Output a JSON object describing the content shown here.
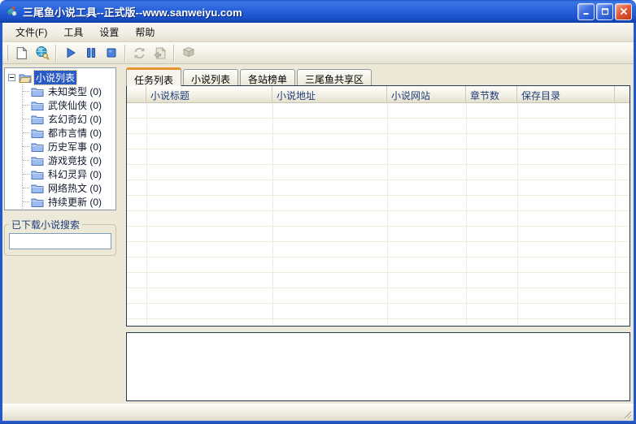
{
  "window": {
    "title": "三尾鱼小说工具--正式版--www.sanweiyu.com",
    "controls": [
      {
        "name": "minimize"
      },
      {
        "name": "maximize"
      },
      {
        "name": "close"
      }
    ]
  },
  "menu": {
    "items": [
      {
        "label": "文件(F)"
      },
      {
        "label": "工具"
      },
      {
        "label": "设置"
      },
      {
        "label": "帮助"
      }
    ]
  },
  "toolbar": {
    "buttons": [
      {
        "name": "new-task",
        "icon": "new-document-icon",
        "enabled": true
      },
      {
        "name": "search",
        "icon": "search-globe-icon",
        "enabled": true
      },
      {
        "name": "start",
        "icon": "play-icon",
        "enabled": true
      },
      {
        "name": "pause",
        "icon": "pause-icon",
        "enabled": true
      },
      {
        "name": "stop",
        "icon": "stop-icon",
        "enabled": true
      },
      {
        "name": "refresh",
        "icon": "refresh-icon",
        "enabled": false
      },
      {
        "name": "export",
        "icon": "export-page-icon",
        "enabled": false
      },
      {
        "name": "library",
        "icon": "book-icon",
        "enabled": false
      }
    ]
  },
  "sidebar": {
    "tree": {
      "root": {
        "label": "小说列表",
        "selected": true,
        "expanded": true
      },
      "items": [
        {
          "label": "未知类型 (0)"
        },
        {
          "label": "武侠仙侠 (0)"
        },
        {
          "label": "玄幻奇幻 (0)"
        },
        {
          "label": "都市言情 (0)"
        },
        {
          "label": "历史军事 (0)"
        },
        {
          "label": "游戏竞技 (0)"
        },
        {
          "label": "科幻灵异 (0)"
        },
        {
          "label": "网络热文 (0)"
        },
        {
          "label": "持续更新 (0)"
        }
      ]
    },
    "search": {
      "group_label": "已下载小说搜索",
      "value": ""
    }
  },
  "tabs": [
    {
      "label": "任务列表",
      "active": true
    },
    {
      "label": "小说列表",
      "active": false
    },
    {
      "label": "各站榜单",
      "active": false
    },
    {
      "label": "三尾鱼共享区",
      "active": false
    }
  ],
  "table": {
    "columns": [
      {
        "label": ""
      },
      {
        "label": "小说标题"
      },
      {
        "label": "小说地址"
      },
      {
        "label": "小说网站"
      },
      {
        "label": "章节数"
      },
      {
        "label": "保存目录"
      }
    ],
    "rows": []
  },
  "log": {
    "content": ""
  },
  "statusbar": {
    "text": ""
  },
  "colors": {
    "titlebar_blue": "#2a64dd",
    "window_border": "#2258cf",
    "tab_accent_orange": "#e5932f",
    "tree_selection": "#2a5ac4",
    "header_text": "#1e3c78",
    "panel_beige": "#ece9d8"
  }
}
